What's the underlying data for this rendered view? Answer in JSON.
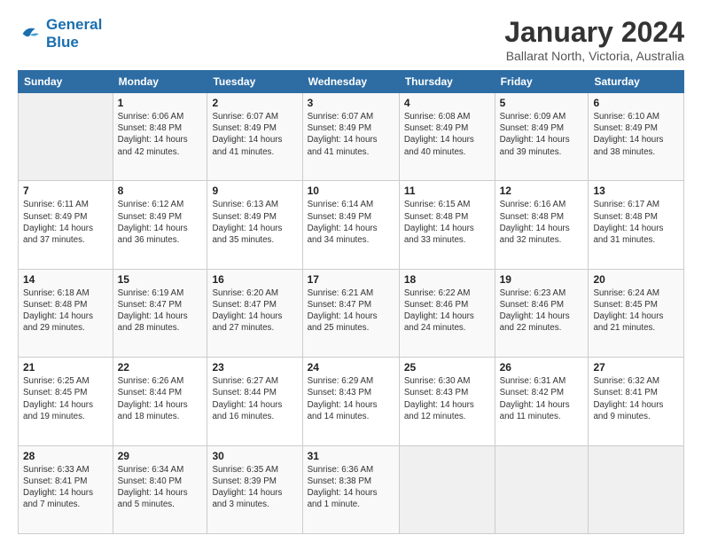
{
  "header": {
    "logo_line1": "General",
    "logo_line2": "Blue",
    "month_title": "January 2024",
    "location": "Ballarat North, Victoria, Australia"
  },
  "days_of_week": [
    "Sunday",
    "Monday",
    "Tuesday",
    "Wednesday",
    "Thursday",
    "Friday",
    "Saturday"
  ],
  "weeks": [
    [
      {
        "day": "",
        "info": ""
      },
      {
        "day": "1",
        "info": "Sunrise: 6:06 AM\nSunset: 8:48 PM\nDaylight: 14 hours\nand 42 minutes."
      },
      {
        "day": "2",
        "info": "Sunrise: 6:07 AM\nSunset: 8:49 PM\nDaylight: 14 hours\nand 41 minutes."
      },
      {
        "day": "3",
        "info": "Sunrise: 6:07 AM\nSunset: 8:49 PM\nDaylight: 14 hours\nand 41 minutes."
      },
      {
        "day": "4",
        "info": "Sunrise: 6:08 AM\nSunset: 8:49 PM\nDaylight: 14 hours\nand 40 minutes."
      },
      {
        "day": "5",
        "info": "Sunrise: 6:09 AM\nSunset: 8:49 PM\nDaylight: 14 hours\nand 39 minutes."
      },
      {
        "day": "6",
        "info": "Sunrise: 6:10 AM\nSunset: 8:49 PM\nDaylight: 14 hours\nand 38 minutes."
      }
    ],
    [
      {
        "day": "7",
        "info": "Sunrise: 6:11 AM\nSunset: 8:49 PM\nDaylight: 14 hours\nand 37 minutes."
      },
      {
        "day": "8",
        "info": "Sunrise: 6:12 AM\nSunset: 8:49 PM\nDaylight: 14 hours\nand 36 minutes."
      },
      {
        "day": "9",
        "info": "Sunrise: 6:13 AM\nSunset: 8:49 PM\nDaylight: 14 hours\nand 35 minutes."
      },
      {
        "day": "10",
        "info": "Sunrise: 6:14 AM\nSunset: 8:49 PM\nDaylight: 14 hours\nand 34 minutes."
      },
      {
        "day": "11",
        "info": "Sunrise: 6:15 AM\nSunset: 8:48 PM\nDaylight: 14 hours\nand 33 minutes."
      },
      {
        "day": "12",
        "info": "Sunrise: 6:16 AM\nSunset: 8:48 PM\nDaylight: 14 hours\nand 32 minutes."
      },
      {
        "day": "13",
        "info": "Sunrise: 6:17 AM\nSunset: 8:48 PM\nDaylight: 14 hours\nand 31 minutes."
      }
    ],
    [
      {
        "day": "14",
        "info": "Sunrise: 6:18 AM\nSunset: 8:48 PM\nDaylight: 14 hours\nand 29 minutes."
      },
      {
        "day": "15",
        "info": "Sunrise: 6:19 AM\nSunset: 8:47 PM\nDaylight: 14 hours\nand 28 minutes."
      },
      {
        "day": "16",
        "info": "Sunrise: 6:20 AM\nSunset: 8:47 PM\nDaylight: 14 hours\nand 27 minutes."
      },
      {
        "day": "17",
        "info": "Sunrise: 6:21 AM\nSunset: 8:47 PM\nDaylight: 14 hours\nand 25 minutes."
      },
      {
        "day": "18",
        "info": "Sunrise: 6:22 AM\nSunset: 8:46 PM\nDaylight: 14 hours\nand 24 minutes."
      },
      {
        "day": "19",
        "info": "Sunrise: 6:23 AM\nSunset: 8:46 PM\nDaylight: 14 hours\nand 22 minutes."
      },
      {
        "day": "20",
        "info": "Sunrise: 6:24 AM\nSunset: 8:45 PM\nDaylight: 14 hours\nand 21 minutes."
      }
    ],
    [
      {
        "day": "21",
        "info": "Sunrise: 6:25 AM\nSunset: 8:45 PM\nDaylight: 14 hours\nand 19 minutes."
      },
      {
        "day": "22",
        "info": "Sunrise: 6:26 AM\nSunset: 8:44 PM\nDaylight: 14 hours\nand 18 minutes."
      },
      {
        "day": "23",
        "info": "Sunrise: 6:27 AM\nSunset: 8:44 PM\nDaylight: 14 hours\nand 16 minutes."
      },
      {
        "day": "24",
        "info": "Sunrise: 6:29 AM\nSunset: 8:43 PM\nDaylight: 14 hours\nand 14 minutes."
      },
      {
        "day": "25",
        "info": "Sunrise: 6:30 AM\nSunset: 8:43 PM\nDaylight: 14 hours\nand 12 minutes."
      },
      {
        "day": "26",
        "info": "Sunrise: 6:31 AM\nSunset: 8:42 PM\nDaylight: 14 hours\nand 11 minutes."
      },
      {
        "day": "27",
        "info": "Sunrise: 6:32 AM\nSunset: 8:41 PM\nDaylight: 14 hours\nand 9 minutes."
      }
    ],
    [
      {
        "day": "28",
        "info": "Sunrise: 6:33 AM\nSunset: 8:41 PM\nDaylight: 14 hours\nand 7 minutes."
      },
      {
        "day": "29",
        "info": "Sunrise: 6:34 AM\nSunset: 8:40 PM\nDaylight: 14 hours\nand 5 minutes."
      },
      {
        "day": "30",
        "info": "Sunrise: 6:35 AM\nSunset: 8:39 PM\nDaylight: 14 hours\nand 3 minutes."
      },
      {
        "day": "31",
        "info": "Sunrise: 6:36 AM\nSunset: 8:38 PM\nDaylight: 14 hours\nand 1 minute."
      },
      {
        "day": "",
        "info": ""
      },
      {
        "day": "",
        "info": ""
      },
      {
        "day": "",
        "info": ""
      }
    ]
  ]
}
